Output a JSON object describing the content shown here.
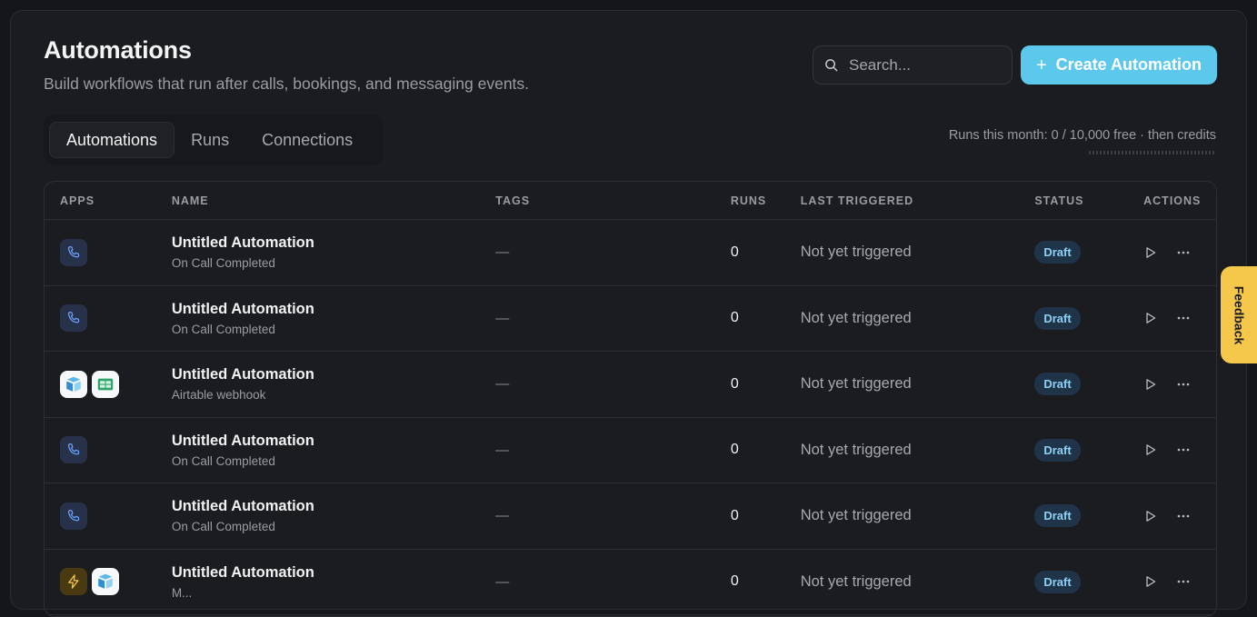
{
  "header": {
    "title": "Automations",
    "subtitle": "Build workflows that run after calls, bookings, and messaging events."
  },
  "search": {
    "placeholder": "Search..."
  },
  "create_button": {
    "icon": "plus-icon",
    "label": "Create Automation"
  },
  "tabs": [
    {
      "label": "Automations",
      "active": true
    },
    {
      "label": "Runs",
      "active": false
    },
    {
      "label": "Connections",
      "active": false
    }
  ],
  "usage": {
    "text": "Runs this month: 0 / 10,000 free · then credits",
    "used_fraction": 0
  },
  "table": {
    "columns": {
      "apps": "APPS",
      "name": "NAME",
      "tags": "TAGS",
      "runs": "RUNS",
      "last": "LAST TRIGGERED",
      "status": "STATUS",
      "actions": "ACTIONS"
    },
    "rows": [
      {
        "apps": [
          "phone-icon"
        ],
        "name": "Untitled Automation",
        "trigger": "On Call Completed",
        "tags": "—",
        "runs": "0",
        "last": "Not yet triggered",
        "status": "Draft"
      },
      {
        "apps": [
          "phone-icon"
        ],
        "name": "Untitled Automation",
        "trigger": "On Call Completed",
        "tags": "—",
        "runs": "0",
        "last": "Not yet triggered",
        "status": "Draft"
      },
      {
        "apps": [
          "airtable-icon",
          "sheets-icon"
        ],
        "name": "Untitled Automation",
        "trigger": "Airtable webhook",
        "tags": "—",
        "runs": "0",
        "last": "Not yet triggered",
        "status": "Draft"
      },
      {
        "apps": [
          "phone-icon"
        ],
        "name": "Untitled Automation",
        "trigger": "On Call Completed",
        "tags": "—",
        "runs": "0",
        "last": "Not yet triggered",
        "status": "Draft"
      },
      {
        "apps": [
          "phone-icon"
        ],
        "name": "Untitled Automation",
        "trigger": "On Call Completed",
        "tags": "—",
        "runs": "0",
        "last": "Not yet triggered",
        "status": "Draft"
      },
      {
        "apps": [
          "bolt-icon",
          "airtable-icon"
        ],
        "name": "Untitled Automation",
        "trigger": "M...",
        "tags": "—",
        "runs": "0",
        "last": "Not yet triggered",
        "status": "Draft"
      }
    ]
  },
  "feedback": {
    "label": "Feedback"
  },
  "colors": {
    "accent": "#5cc8ec",
    "badge_bg": "#1f3448",
    "badge_text": "#8fd0f2",
    "feedback": "#f5c84b"
  }
}
